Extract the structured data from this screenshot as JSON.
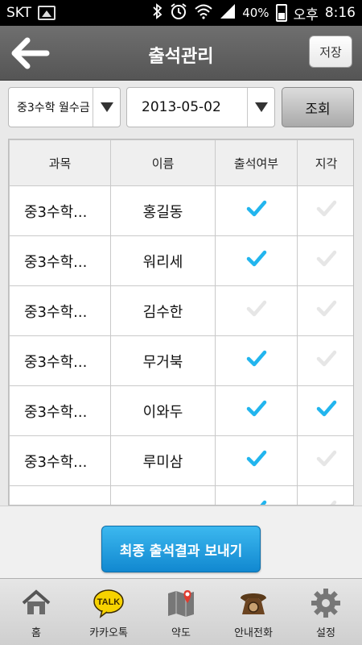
{
  "status_bar": {
    "carrier": "SKT",
    "battery": "40%",
    "ampm": "오후",
    "time": "8:16"
  },
  "header": {
    "title": "출석관리",
    "save_label": "저장"
  },
  "filters": {
    "class_selected": "중3수학 월수금",
    "date_selected": "2013-05-02",
    "search_label": "조회"
  },
  "table": {
    "headers": [
      "과목",
      "이름",
      "출석여부",
      "지각"
    ],
    "rows": [
      {
        "subject": "중3수학...",
        "name": "홍길동",
        "attended": true,
        "late": false
      },
      {
        "subject": "중3수학...",
        "name": "워리세",
        "attended": true,
        "late": false
      },
      {
        "subject": "중3수학...",
        "name": "김수한",
        "attended": false,
        "late": false
      },
      {
        "subject": "중3수학...",
        "name": "무거북",
        "attended": true,
        "late": false
      },
      {
        "subject": "중3수학...",
        "name": "이와두",
        "attended": true,
        "late": true
      },
      {
        "subject": "중3수학...",
        "name": "루미삼",
        "attended": true,
        "late": false
      },
      {
        "subject": "",
        "name": "",
        "attended": true,
        "late": false
      }
    ]
  },
  "send_label": "최종 출석결과 보내기",
  "bottom_nav": [
    {
      "label": "홈",
      "icon": "home-icon"
    },
    {
      "label": "카카오톡",
      "icon": "kakaotalk-icon",
      "badge": "TALK"
    },
    {
      "label": "약도",
      "icon": "map-icon"
    },
    {
      "label": "안내전화",
      "icon": "phone-icon"
    },
    {
      "label": "설정",
      "icon": "gear-icon"
    }
  ],
  "colors": {
    "check_on": "#22b5ee",
    "check_off": "#e6e6e6",
    "accent": "#1a9ee0"
  }
}
